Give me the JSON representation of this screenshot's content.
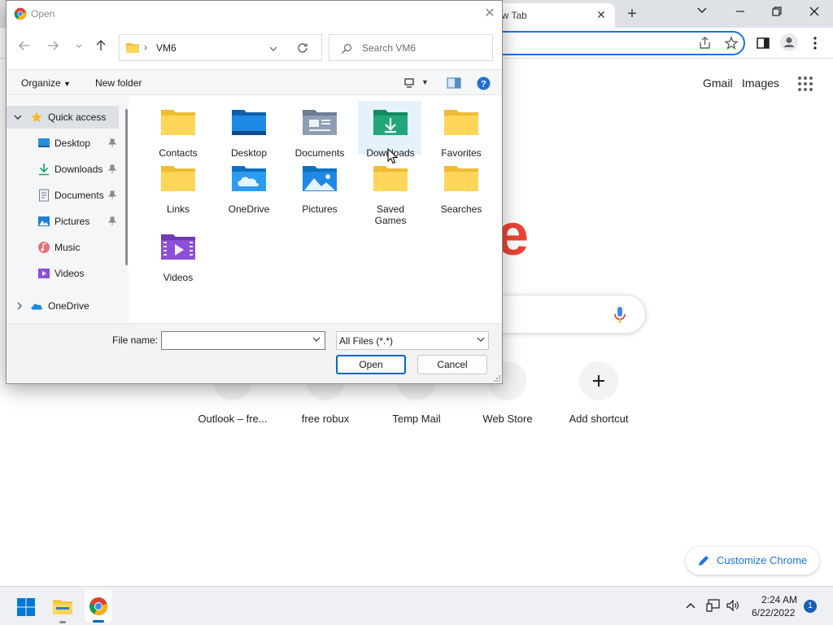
{
  "chrome": {
    "tab_title": "ew Tab",
    "header_links": [
      "Gmail",
      "Images"
    ],
    "shortcuts": [
      {
        "label": "Outlook – fre..."
      },
      {
        "label": "free robux"
      },
      {
        "label": "Temp Mail"
      },
      {
        "label": "Web Store"
      },
      {
        "label": "Add shortcut"
      }
    ],
    "customize_label": "Customize Chrome",
    "logo_fragment": "e",
    "accent_color": "#1a73e8"
  },
  "dialog": {
    "title": "Open",
    "address": {
      "current_folder": "VM6"
    },
    "search_placeholder": "Search VM6",
    "toolbar": {
      "organize": "Organize",
      "new_folder": "New folder"
    },
    "nav_items": [
      {
        "label": "Quick access",
        "icon": "star-icon",
        "selected": true,
        "expanded": true
      },
      {
        "label": "Desktop",
        "icon": "desktop-icon",
        "pinned": true
      },
      {
        "label": "Downloads",
        "icon": "download-icon",
        "pinned": true
      },
      {
        "label": "Documents",
        "icon": "document-icon",
        "pinned": true
      },
      {
        "label": "Pictures",
        "icon": "pictures-icon",
        "pinned": true
      },
      {
        "label": "Music",
        "icon": "music-icon",
        "pinned": false
      },
      {
        "label": "Videos",
        "icon": "videos-icon",
        "pinned": false
      },
      {
        "label": "OneDrive",
        "icon": "cloud-icon",
        "collapsed": true
      }
    ],
    "files": [
      {
        "name": "Contacts",
        "icon": "folder-icon"
      },
      {
        "name": "Desktop",
        "icon": "desktop-folder-icon"
      },
      {
        "name": "Documents",
        "icon": "documents-folder-icon"
      },
      {
        "name": "Downloads",
        "icon": "downloads-folder-icon",
        "hovered": true
      },
      {
        "name": "Favorites",
        "icon": "folder-icon"
      },
      {
        "name": "Links",
        "icon": "folder-icon"
      },
      {
        "name": "OneDrive",
        "icon": "onedrive-folder-icon"
      },
      {
        "name": "Pictures",
        "icon": "pictures-folder-icon"
      },
      {
        "name": "Saved Games",
        "icon": "folder-icon"
      },
      {
        "name": "Searches",
        "icon": "folder-icon"
      },
      {
        "name": "Videos",
        "icon": "videos-folder-icon"
      }
    ],
    "file_name_label": "File name:",
    "file_name_value": "",
    "file_type": "All Files (*.*)",
    "open_label": "Open",
    "cancel_label": "Cancel"
  },
  "taskbar": {
    "time": "2:24 AM",
    "date": "6/22/2022",
    "notification_count": "1"
  }
}
